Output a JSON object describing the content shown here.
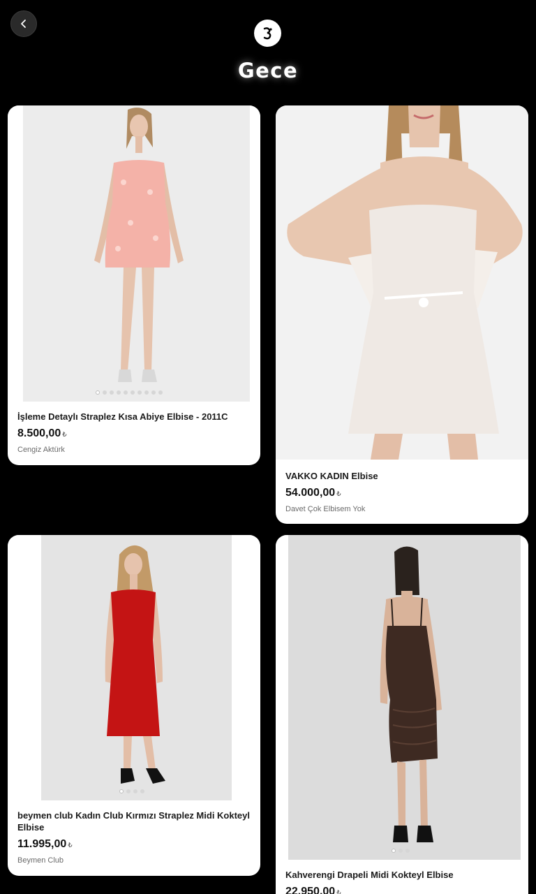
{
  "header": {
    "title": "Gece",
    "back_icon": "chevron-left-icon",
    "logo_icon": "brand-logo-icon"
  },
  "products": [
    {
      "title": "İşleme Detaylı Straplez Kısa Abiye Elbise - 2011C",
      "price": "8.500,00",
      "currency": "₺",
      "seller": "Cengiz Aktürk",
      "image": "pink-strapless-mini-dress-photo",
      "dress_color": "#f4b2a8"
    },
    {
      "title": "VAKKO KADIN Elbise",
      "price": "54.000,00",
      "currency": "₺",
      "seller": "Davet Çok Elbisem Yok",
      "image": "white-lace-mini-dress-photo",
      "dress_color": "#efe9e4"
    },
    {
      "title": "beymen club Kadın Club Kırmızı Straplez Midi Kokteyl Elbise",
      "price": "11.995,00",
      "currency": "₺",
      "seller": "Beymen Club",
      "image": "red-strapless-midi-dress-photo",
      "dress_color": "#c41414"
    },
    {
      "title": "Kahverengi Drapeli Midi Kokteyl Elbise",
      "price": "22.950,00",
      "currency": "₺",
      "seller": "",
      "image": "brown-draped-midi-dress-photo",
      "dress_color": "#3e2a22"
    }
  ]
}
